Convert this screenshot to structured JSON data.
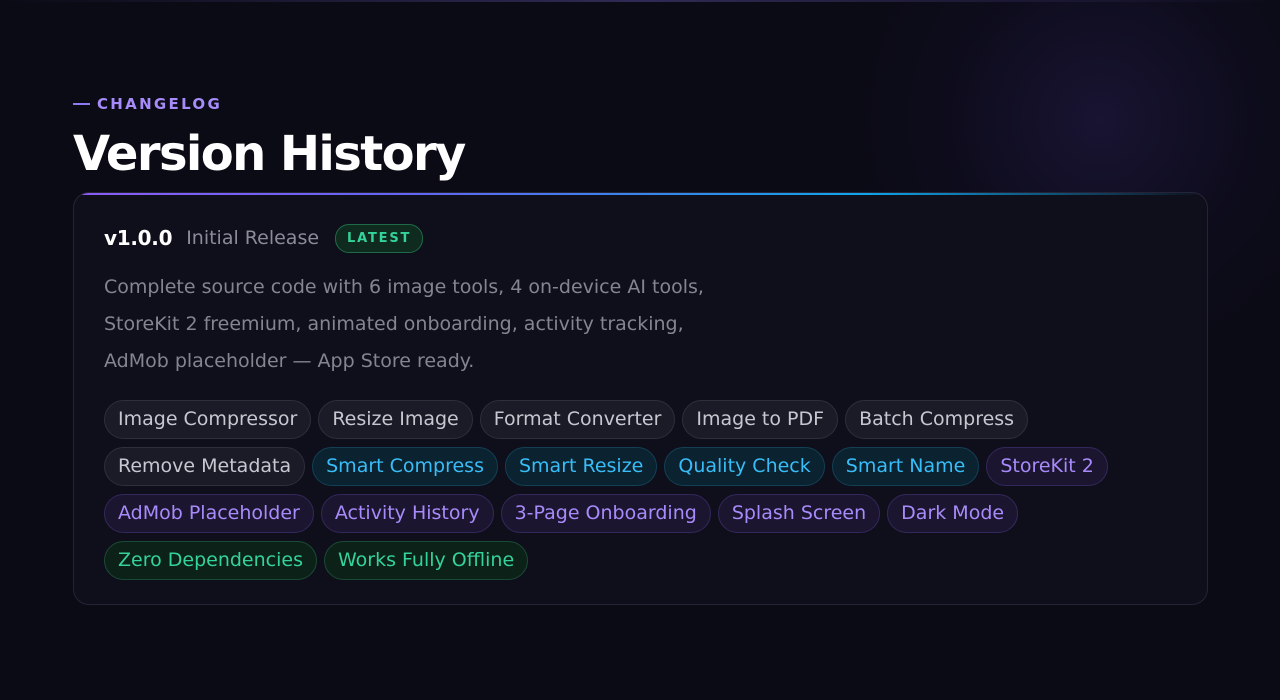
{
  "header": {
    "eyebrow": "CHANGELOG",
    "title": "Version History"
  },
  "release": {
    "version": "v1.0.0",
    "name": "Initial Release",
    "badge": "LATEST",
    "description_lines": [
      "Complete source code with 6 image tools, 4 on-device AI tools,",
      "StoreKit 2 freemium, animated onboarding, activity tracking,",
      "AdMob placeholder — App Store ready."
    ],
    "tags": [
      {
        "label": "Image Compressor",
        "style": "gray"
      },
      {
        "label": "Resize Image",
        "style": "gray"
      },
      {
        "label": "Format Converter",
        "style": "gray"
      },
      {
        "label": "Image to PDF",
        "style": "gray"
      },
      {
        "label": "Batch Compress",
        "style": "gray"
      },
      {
        "label": "Remove Metadata",
        "style": "gray"
      },
      {
        "label": "Smart Compress",
        "style": "cyan"
      },
      {
        "label": "Smart Resize",
        "style": "cyan"
      },
      {
        "label": "Quality Check",
        "style": "cyan"
      },
      {
        "label": "Smart Name",
        "style": "cyan"
      },
      {
        "label": "StoreKit 2",
        "style": "purple"
      },
      {
        "label": "AdMob Placeholder",
        "style": "purple"
      },
      {
        "label": "Activity History",
        "style": "purple"
      },
      {
        "label": "3-Page Onboarding",
        "style": "purple"
      },
      {
        "label": "Splash Screen",
        "style": "purple"
      },
      {
        "label": "Dark Mode",
        "style": "purple"
      },
      {
        "label": "Zero Dependencies",
        "style": "green"
      },
      {
        "label": "Works Fully Offline",
        "style": "green"
      }
    ]
  },
  "colors": {
    "background": "#0b0b16",
    "accent_purple": "#a78bfa",
    "accent_cyan": "#38bdf8",
    "accent_green": "#34d399",
    "muted_text": "#85858f"
  }
}
